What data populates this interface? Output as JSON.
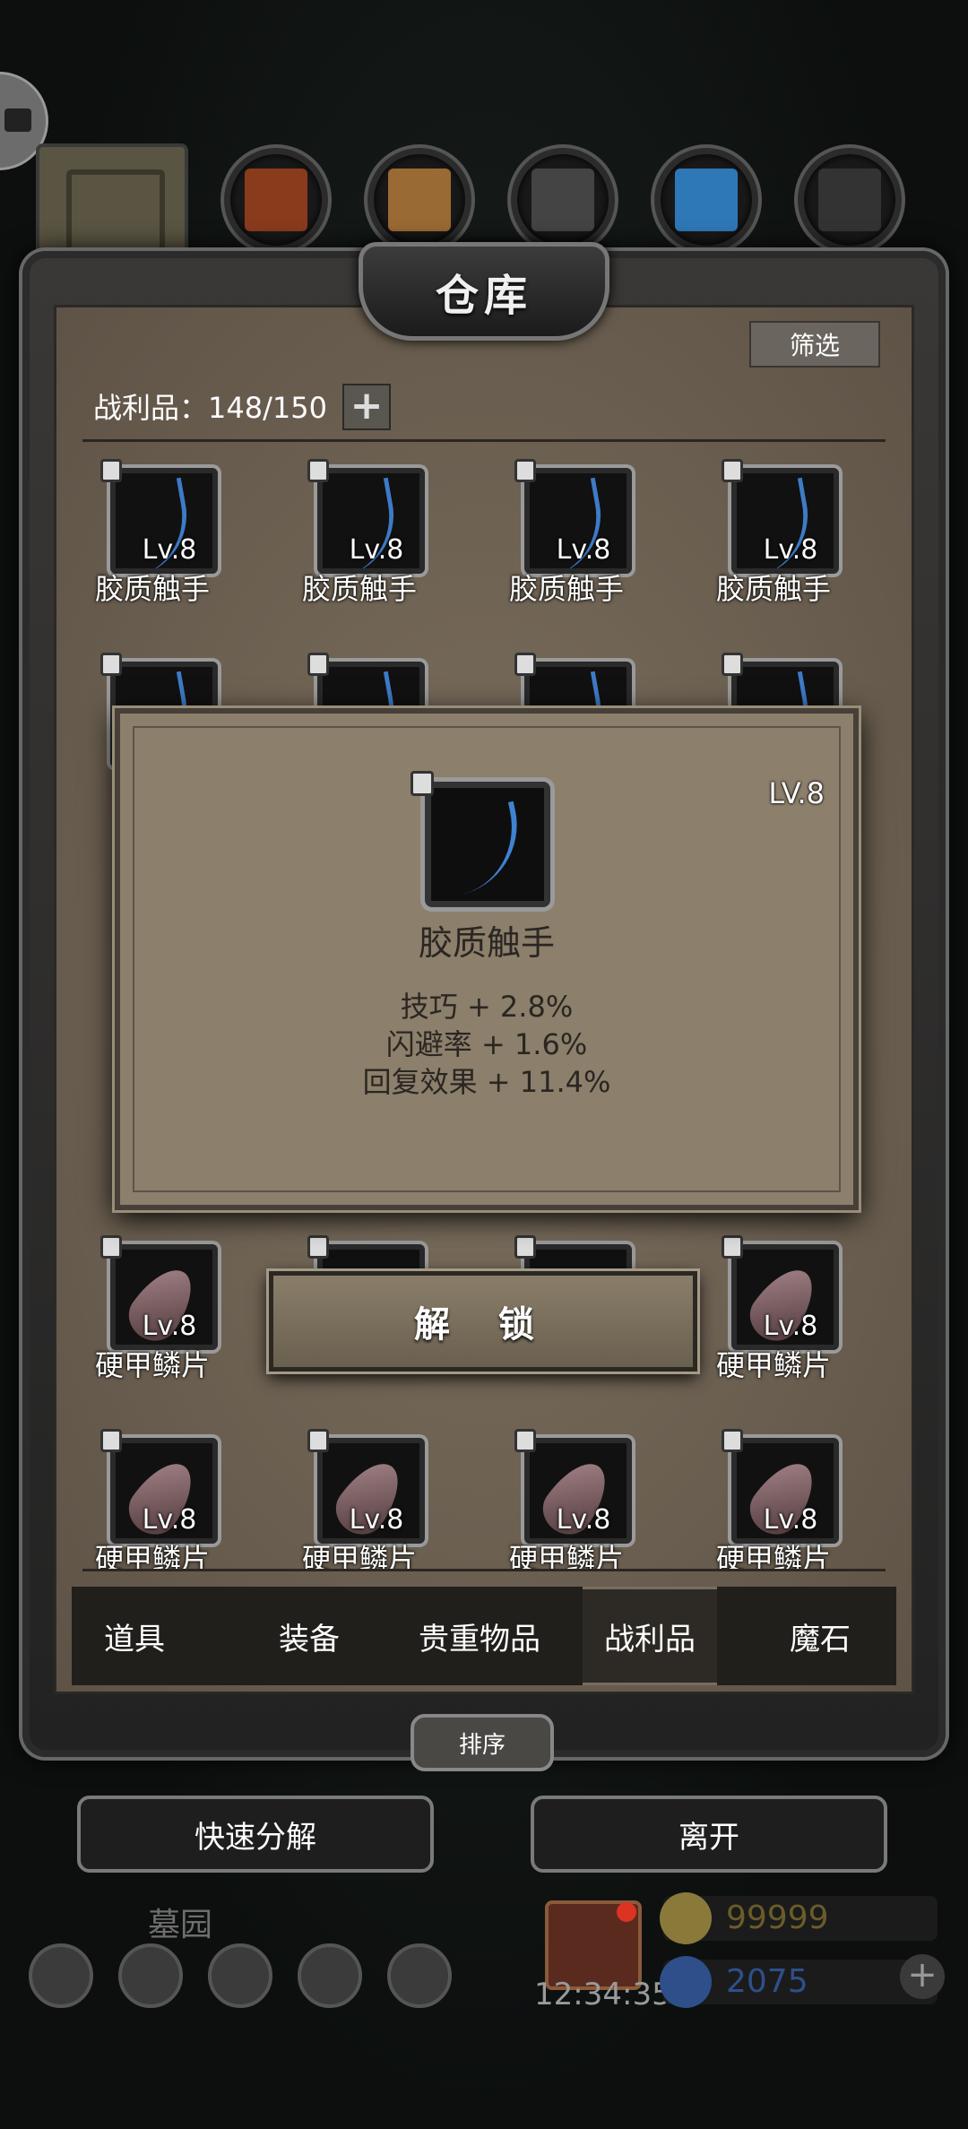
{
  "header": {
    "title": "仓库",
    "filter_label": "筛选"
  },
  "inventory": {
    "count_label": "战利品：148/150",
    "add_icon": "+"
  },
  "items_top": [
    {
      "level": "Lv.8",
      "name": "胶质触手"
    },
    {
      "level": "Lv.8",
      "name": "胶质触手"
    },
    {
      "level": "Lv.8",
      "name": "胶质触手"
    },
    {
      "level": "Lv.8",
      "name": "胶质触手"
    }
  ],
  "items_scales_row": [
    {
      "level": "Lv.8",
      "name": "硬甲鳞片"
    },
    {
      "level": "Lv.8",
      "name": "硬甲鳞片"
    }
  ],
  "items_bottom": [
    {
      "level": "Lv.8",
      "name": "硬甲鳞片"
    },
    {
      "level": "Lv.8",
      "name": "硬甲鳞片"
    },
    {
      "level": "Lv.8",
      "name": "硬甲鳞片"
    },
    {
      "level": "Lv.8",
      "name": "硬甲鳞片"
    }
  ],
  "popup": {
    "level": "LV.8",
    "name": "胶质触手",
    "stats": [
      "技巧 + 2.8%",
      "闪避率 + 1.6%",
      "回复效果 + 11.4%"
    ],
    "unlock_label": "解 锁"
  },
  "tabs": [
    "道具",
    "装备",
    "贵重物品",
    "战利品",
    "魔石"
  ],
  "sort_label": "排序",
  "actions": {
    "decompose": "快速分解",
    "leave": "离开"
  },
  "hud": {
    "location": "墓园",
    "timer": "12:34:35",
    "gold": "99999",
    "gems": "2075"
  },
  "colors": {
    "gold": "#8a7a3a",
    "gems": "#2e4f8a",
    "accent_blue": "#3d7bc7"
  }
}
